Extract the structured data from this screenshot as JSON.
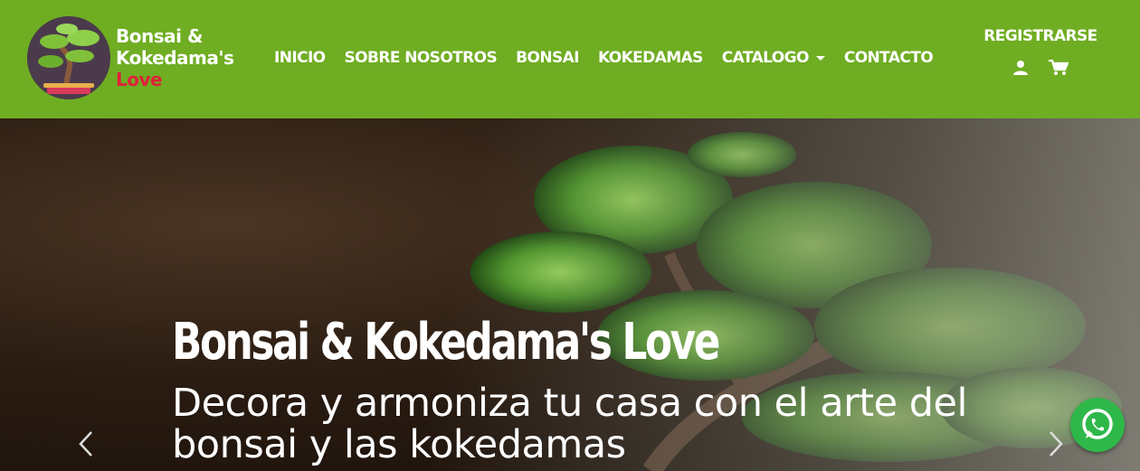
{
  "brand": {
    "line1": "Bonsai &",
    "line2": "Kokedama's",
    "line3": "Love",
    "logo_icon": "bonsai-logo-icon"
  },
  "nav": {
    "items": [
      {
        "label": "INICIO"
      },
      {
        "label": "SOBRE NOSOTROS"
      },
      {
        "label": "BONSAI"
      },
      {
        "label": "KOKEDAMAS"
      },
      {
        "label": "CATALOGO",
        "dropdown": true
      },
      {
        "label": "CONTACTO"
      }
    ]
  },
  "account": {
    "register_label": "REGISTRARSE",
    "user_icon": "user-icon",
    "cart_icon": "cart-icon"
  },
  "hero": {
    "title": "Bonsai & Kokedama's Love",
    "subtitle": "Decora y armoniza tu casa con el arte del bonsai y las kokedamas",
    "prev_icon": "chevron-left-icon",
    "next_icon": "chevron-right-icon"
  },
  "floating": {
    "whatsapp_icon": "whatsapp-icon"
  },
  "colors": {
    "navbar": "#6fad22",
    "brand_accent": "#e0203a",
    "whatsapp": "#2fb84a"
  }
}
